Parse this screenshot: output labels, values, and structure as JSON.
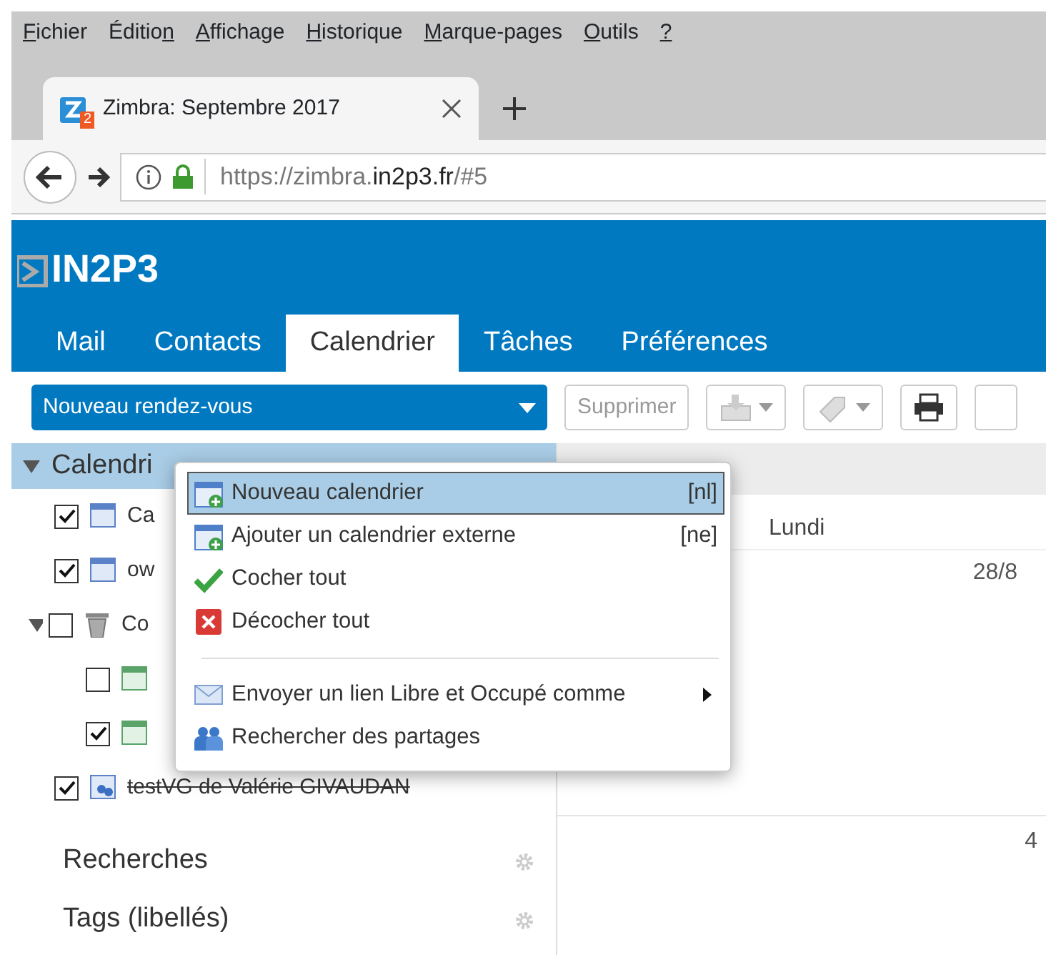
{
  "browser": {
    "menu": [
      {
        "key": "F",
        "post": "ichier"
      },
      {
        "pre": "Éditio",
        "key": "n"
      },
      {
        "key": "A",
        "post": "ffichage"
      },
      {
        "key": "H",
        "post": "istorique"
      },
      {
        "key": "M",
        "post": "arque-pages"
      },
      {
        "key": "O",
        "post": "utils"
      },
      {
        "key": "?"
      }
    ],
    "tab": {
      "title": "Zimbra: Septembre 2017",
      "badge": "2"
    },
    "url": {
      "scheme": "https://zimbra.",
      "domain": "in2p3.fr",
      "path": "/#5"
    }
  },
  "app": {
    "logo": "IN2P3",
    "tabs": [
      {
        "label": "Mail",
        "selected": false
      },
      {
        "label": "Contacts",
        "selected": false
      },
      {
        "label": "Calendrier",
        "selected": true
      },
      {
        "label": "Tâches",
        "selected": false
      },
      {
        "label": "Préférences",
        "selected": false
      }
    ],
    "toolbar": {
      "new_button": "Nouveau rendez-vous",
      "delete_button": {
        "label": "Supprimer",
        "disabled": true
      }
    },
    "sidebar": {
      "header": {
        "label": "Calendri",
        "expanded": true
      },
      "items": [
        {
          "kind": "calendar",
          "label": "Ca",
          "checked": true,
          "struck": false
        },
        {
          "kind": "calendar",
          "label": "ow",
          "checked": true,
          "struck": false
        },
        {
          "kind": "trash",
          "label": "Co",
          "checked": false,
          "struck": false,
          "expanded": true,
          "children": [
            {
              "kind": "green-calendar",
              "checked": false
            },
            {
              "kind": "green-calendar",
              "checked": true
            }
          ]
        },
        {
          "kind": "shared",
          "label": "testVG de Valérie GIVAUDAN",
          "checked": true,
          "struck": true
        }
      ],
      "sections": [
        "Recherches",
        "Tags (libellés)"
      ]
    },
    "calendar": {
      "day": "Lundi",
      "dates": [
        "28/8",
        "4"
      ]
    },
    "context_menu": [
      {
        "kind": "new-calendar",
        "label": "Nouveau calendrier",
        "shortcut": "[nl]",
        "selected": true
      },
      {
        "kind": "new-calendar",
        "label": "Ajouter un calendrier externe",
        "shortcut": "[ne]",
        "selected": false
      },
      {
        "kind": "check",
        "label": "Cocher tout",
        "selected": false
      },
      {
        "kind": "uncheck",
        "label": "Décocher tout",
        "selected": false
      },
      {
        "kind": "separator"
      },
      {
        "kind": "mail",
        "label": "Envoyer un lien Libre et Occupé comme",
        "submenu": true,
        "selected": false
      },
      {
        "kind": "people",
        "label": "Rechercher des partages",
        "selected": false
      }
    ]
  }
}
